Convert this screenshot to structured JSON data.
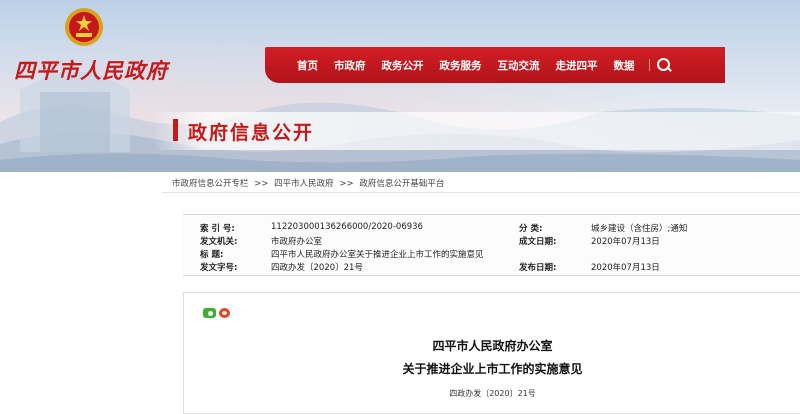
{
  "header": {
    "site_title": "四平市人民政府",
    "emblem_icon": "national-emblem-icon",
    "nav": {
      "items": [
        "首页",
        "市政府",
        "政务公开",
        "政务服务",
        "互动交流",
        "走进四平",
        "数据"
      ],
      "search_icon": "search-icon"
    },
    "section_title": "政府信息公开",
    "brand_color": "#c41a1a"
  },
  "breadcrumb": {
    "items": [
      "市政府信息公开专栏",
      "四平市人民政府",
      "政府信息公开基础平台"
    ],
    "separator": ">>"
  },
  "info": {
    "index_label": "索 引 号:",
    "index_value": "11220300013626600​0/2020-06936",
    "issuer_label": "发文机关:",
    "issuer_value": "市政府办公室",
    "title_label": "标    题:",
    "title_value": "四平市人民政府办公室关于推进企业上市工作的实施意见",
    "number_label": "发文字号:",
    "number_value": "四政办发〔2020〕21号",
    "category_label": "分    类:",
    "category_value": "城乡建设（含住房）;通知",
    "date_label": "成文日期:",
    "date_value": "2020年07月13日",
    "publish_label": "发布日期:",
    "publish_value": "2020年07月13日"
  },
  "document": {
    "share_icons": [
      "wechat-icon",
      "weibo-icon"
    ],
    "issuer": "四平市人民政府办公室",
    "title": "关于推进企业上市工作的实施意见",
    "number": "四政办发〔2020〕21号"
  }
}
